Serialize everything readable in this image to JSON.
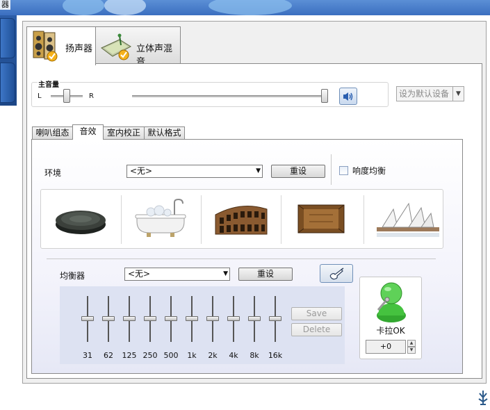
{
  "window": {
    "title_fragment": "器"
  },
  "tabs": [
    {
      "label": "扬声器",
      "active": true
    },
    {
      "label": "立体声混音",
      "active": false
    }
  ],
  "volume": {
    "label": "主音量",
    "balance_left": "L",
    "balance_right": "R",
    "balance_position": 0.5,
    "level": 1.0,
    "default_device_label": "设为默认设备"
  },
  "subtabs": [
    {
      "label": "喇叭组态",
      "active": false
    },
    {
      "label": "音效",
      "active": true
    },
    {
      "label": "室内校正",
      "active": false
    },
    {
      "label": "默认格式",
      "active": false
    }
  ],
  "environment": {
    "label": "环境",
    "selected": "<无>",
    "reset_label": "重设",
    "loudness_label": "响度均衡",
    "loudness_checked": false,
    "presets": [
      "stone-disc-icon",
      "bathtub-icon",
      "colosseum-icon",
      "padded-cell-icon",
      "opera-house-icon"
    ]
  },
  "equalizer": {
    "label": "均衡器",
    "selected": "<无>",
    "reset_label": "重设",
    "save_label": "Save",
    "delete_label": "Delete",
    "bands": [
      "31",
      "62",
      "125",
      "250",
      "500",
      "1k",
      "2k",
      "4k",
      "8k",
      "16k"
    ],
    "band_levels": [
      0,
      0,
      0,
      0,
      0,
      0,
      0,
      0,
      0,
      0
    ]
  },
  "karaoke": {
    "label": "卡拉OK",
    "value": "+0"
  },
  "colors": {
    "accent": "#3b6fc0",
    "panel": "#f0f0f0"
  }
}
